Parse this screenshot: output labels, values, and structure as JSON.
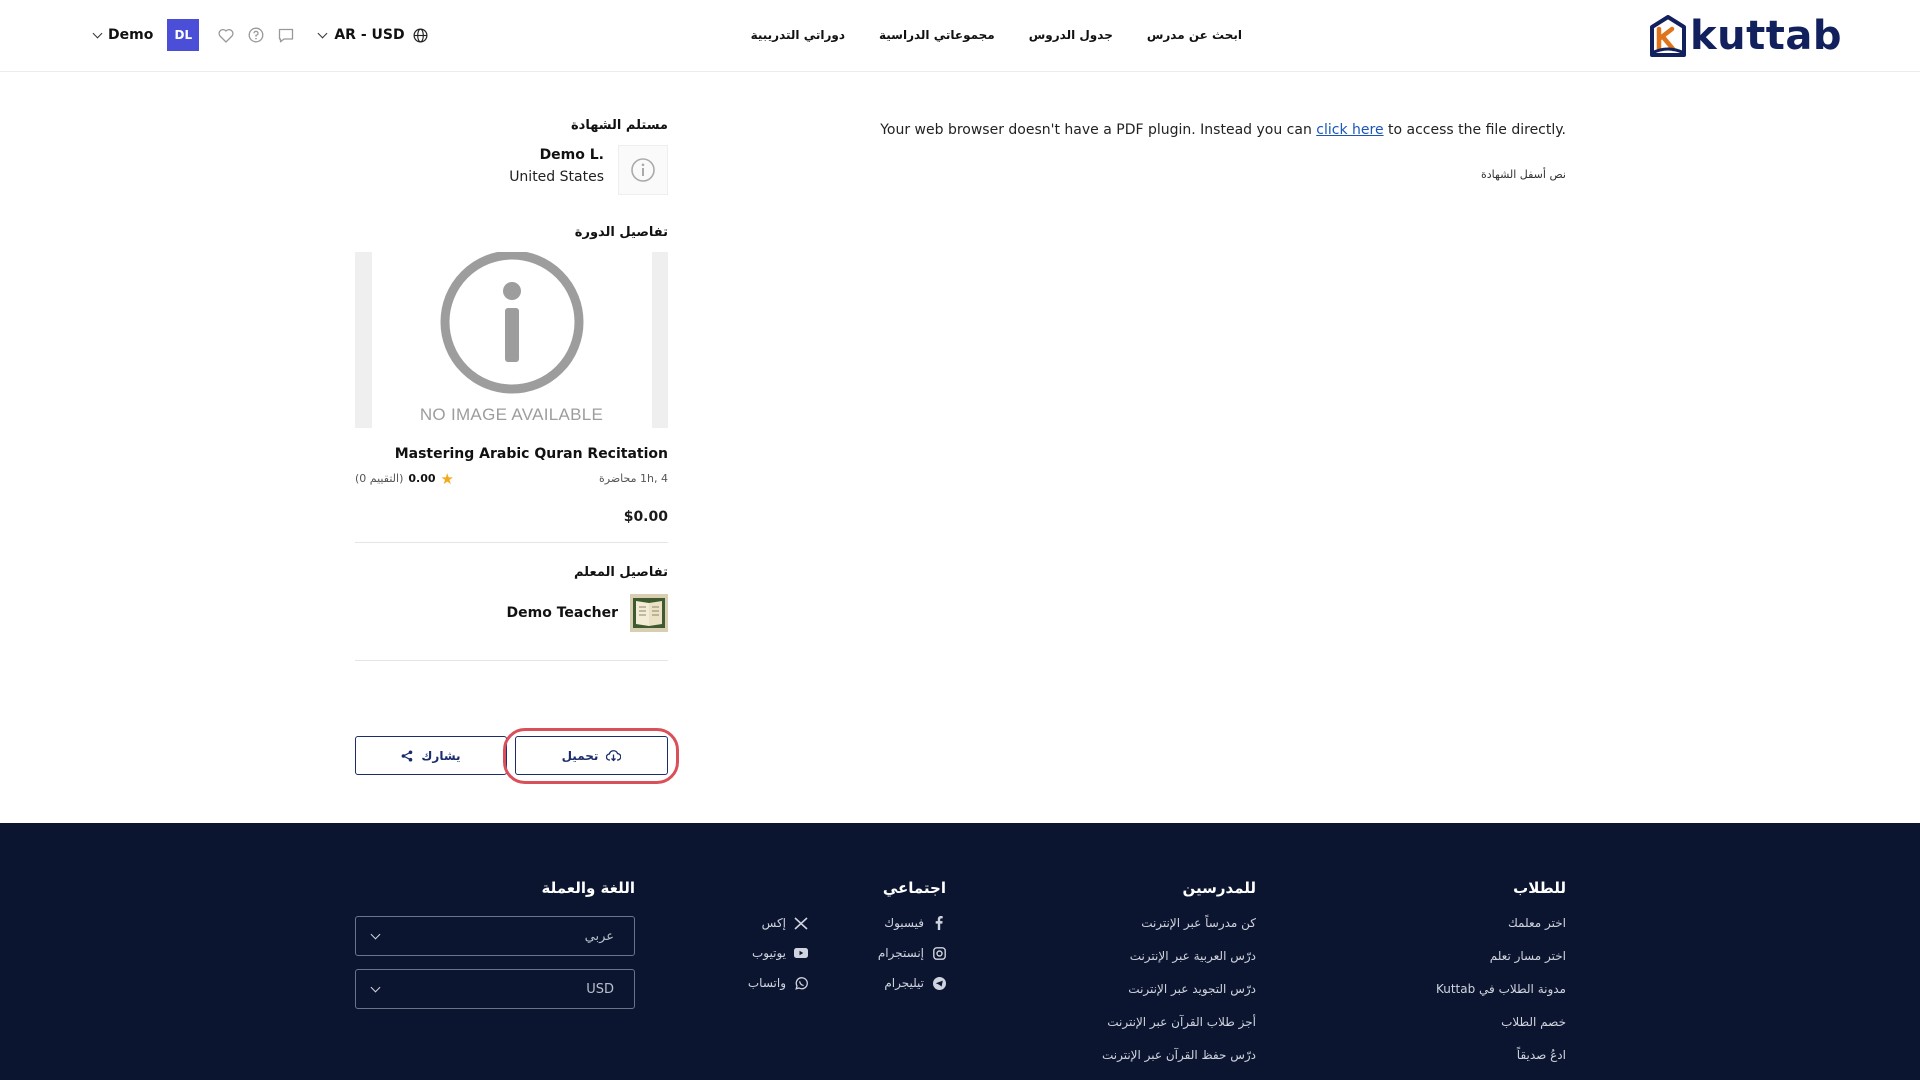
{
  "header": {
    "logo_text": "kuttab",
    "nav": [
      {
        "label": "ابحث عن مدرس"
      },
      {
        "label": "جدول الدروس"
      },
      {
        "label": "مجموعاتي الدراسية"
      },
      {
        "label": "دوراتي التدريبية"
      }
    ],
    "user_name": "Demo",
    "avatar_initials": "DL",
    "locale": "AR - USD"
  },
  "main": {
    "pdf_message_pre": "Your web browser doesn't have a PDF plugin. Instead you can ",
    "pdf_message_link": "click here",
    "pdf_message_post": " to access the file directly.",
    "cert_footer_text": "نص أسفل الشهادة"
  },
  "sidebar": {
    "recipient_title": "مستلم الشهادة",
    "recipient_name": "Demo L.",
    "recipient_country": "United States",
    "course_title": "تفاصيل الدورة",
    "no_image_text": "NO IMAGE AVAILABLE",
    "course_name": "Mastering Arabic Quran Recitation",
    "course_lectures": "4 ,1h محاضرة",
    "rating_value": "0.00",
    "rating_count": "(0 التقييم)",
    "price": "$0.00",
    "teacher_title": "تفاصيل المعلم",
    "teacher_name": "Demo Teacher",
    "download_label": "تحميل",
    "share_label": "يشارك"
  },
  "footer": {
    "students": {
      "title": "للطلاب",
      "links": [
        "اختر معلمك",
        "اختر مسار تعلم",
        "مدونة الطلاب في Kuttab",
        "خصم الطلاب",
        "ادعُ صديقاً"
      ]
    },
    "teachers": {
      "title": "للمدرسين",
      "links": [
        "كن مدرساً عبر الإنترنت",
        "درّس العربية عبر الإنترنت",
        "درّس التجويد عبر الإنترنت",
        "أجز طلاب القرآن عبر الإنترنت",
        "درّس حفظ القرآن عبر الإنترنت"
      ]
    },
    "social": {
      "title": "اجتماعي",
      "items": [
        {
          "label": "فيسبوك",
          "icon": "facebook-icon"
        },
        {
          "label": "إكس",
          "icon": "x-icon"
        },
        {
          "label": "إنستجرام",
          "icon": "instagram-icon"
        },
        {
          "label": "يوتيوب",
          "icon": "youtube-icon"
        },
        {
          "label": "تيليجرام",
          "icon": "telegram-icon"
        },
        {
          "label": "واتساب",
          "icon": "whatsapp-icon"
        }
      ]
    },
    "lang": {
      "title": "اللغة والعملة",
      "language_value": "عربي",
      "currency_value": "USD"
    }
  },
  "colors": {
    "brand_navy": "#12205e",
    "avatar_bg": "#4b4fd7",
    "footer_bg": "#0b1530",
    "focus_ring": "#d9505a",
    "star": "#f4a81d"
  }
}
